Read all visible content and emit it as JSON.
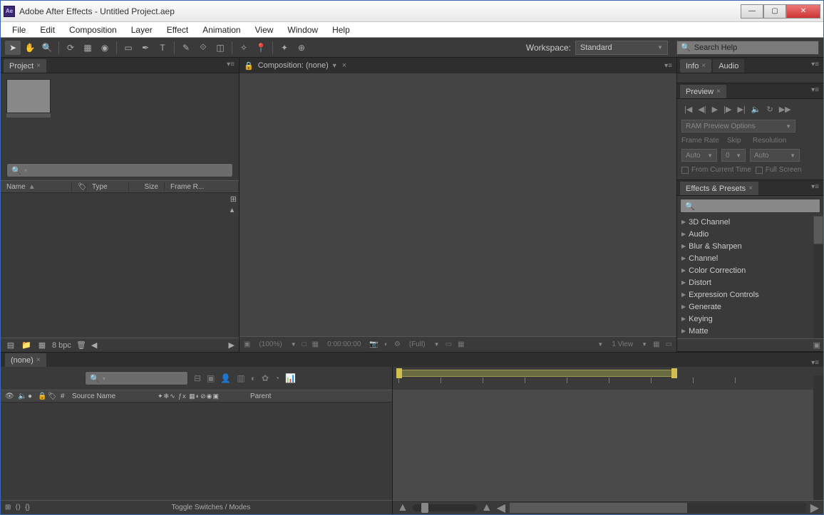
{
  "title": "Adobe After Effects - Untitled Project.aep",
  "menu": [
    "File",
    "Edit",
    "Composition",
    "Layer",
    "Effect",
    "Animation",
    "View",
    "Window",
    "Help"
  ],
  "workspace_label": "Workspace:",
  "workspace_value": "Standard",
  "search_help_placeholder": "Search Help",
  "project": {
    "tab": "Project",
    "search_placeholder": "",
    "columns": {
      "name": "Name",
      "type": "Type",
      "size": "Size",
      "framer": "Frame R..."
    },
    "footer_bpc": "8 bpc"
  },
  "composition": {
    "tab_label": "Composition: (none)",
    "footer_zoom": "(100%)",
    "footer_time": "0:00:00:00",
    "footer_res": "(Full)",
    "footer_view": "1 View"
  },
  "info": {
    "tab": "Info",
    "tab2": "Audio"
  },
  "preview": {
    "tab": "Preview",
    "ram_options": "RAM Preview Options",
    "framerate_lbl": "Frame Rate",
    "skip_lbl": "Skip",
    "resolution_lbl": "Resolution",
    "fr_val": "Auto",
    "skip_val": "0",
    "res_val": "Auto",
    "from_current": "From Current Time",
    "full_screen": "Full Screen"
  },
  "effects": {
    "tab": "Effects & Presets",
    "items": [
      "3D Channel",
      "Audio",
      "Blur & Sharpen",
      "Channel",
      "Color Correction",
      "Distort",
      "Expression Controls",
      "Generate",
      "Keying",
      "Matte"
    ]
  },
  "timeline": {
    "tab": "(none)",
    "source_name": "Source Name",
    "parent": "Parent",
    "num": "#",
    "toggle": "Toggle Switches / Modes"
  }
}
